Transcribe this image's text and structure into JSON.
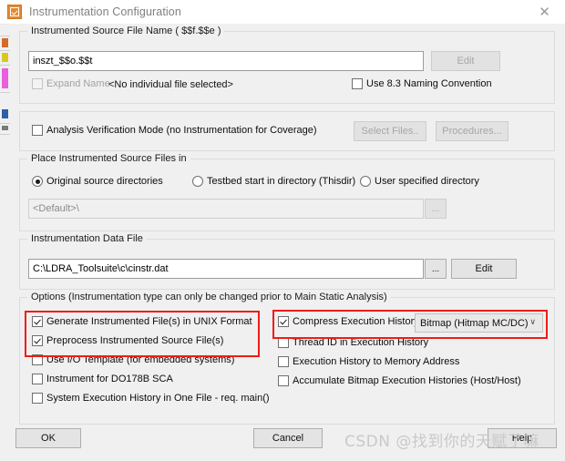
{
  "window": {
    "title": "Instrumentation Configuration",
    "icon": "checkbox-orange-icon",
    "close_label": "✕",
    "accent_color": "#e08a33",
    "annotation_color": "#f01c16"
  },
  "source_file_group": {
    "legend": "Instrumented Source File Name ( $$f.$$e )",
    "filename_value": "inszt_$$o.$$t",
    "filename_placeholder": "",
    "edit_label": "Edit",
    "edit_enabled": false,
    "expand_name_label": "Expand Name",
    "expand_name_checked": false,
    "expand_name_enabled": false,
    "no_file_label": "<No individual file selected>",
    "naming_convention_label": "Use 8.3 Naming Convention",
    "naming_convention_checked": false
  },
  "verification_group": {
    "avm_label": "Analysis Verification Mode (no Instrumentation for Coverage)",
    "avm_checked": false,
    "select_files_label": "Select Files..",
    "select_files_enabled": false,
    "procedures_label": "Procedures...",
    "procedures_enabled": false
  },
  "place_group": {
    "legend": "Place Instrumented Source Files in",
    "radios": [
      {
        "label": "Original source directories",
        "checked": true
      },
      {
        "label": "Testbed start in directory (Thisdir)",
        "checked": false
      },
      {
        "label": "User specified directory",
        "checked": false
      }
    ],
    "directory_value": "<Default>\\",
    "directory_enabled": false,
    "browse_label": "..."
  },
  "data_file_group": {
    "legend": "Instrumentation Data File",
    "path_value": "C:\\LDRA_Toolsuite\\c\\cinstr.dat",
    "browse_label": "...",
    "edit_label": "Edit"
  },
  "options_group": {
    "legend": "Options (Instrumentation type can only be changed prior to Main Static Analysis)",
    "left_column": [
      {
        "label": "Generate Instrumented File(s) in UNIX Format",
        "checked": true
      },
      {
        "label": "Preprocess Instrumented Source File(s)",
        "checked": true
      },
      {
        "label": "Use I/O Template (for embedded systems)",
        "checked": false
      },
      {
        "label": "Instrument for DO178B SCA",
        "checked": false
      },
      {
        "label": "System Execution History in One File - req. main()",
        "checked": false
      }
    ],
    "right_column": [
      {
        "label": "Compress Execution History",
        "checked": true
      },
      {
        "label": "Thread ID in Execution History",
        "checked": false
      },
      {
        "label": "Execution History to Memory Address",
        "checked": false
      },
      {
        "label": "Accumulate Bitmap Execution Histories (Host/Host)",
        "checked": false
      }
    ],
    "compression_combo_value": "Bitmap (Hitmap MC/DC)",
    "combo_arrow": "∨"
  },
  "footer": {
    "ok_label": "OK",
    "cancel_label": "Cancel",
    "help_label": "Help"
  },
  "watermark": {
    "text": "CSDN @找到你的天赋了嘛"
  }
}
